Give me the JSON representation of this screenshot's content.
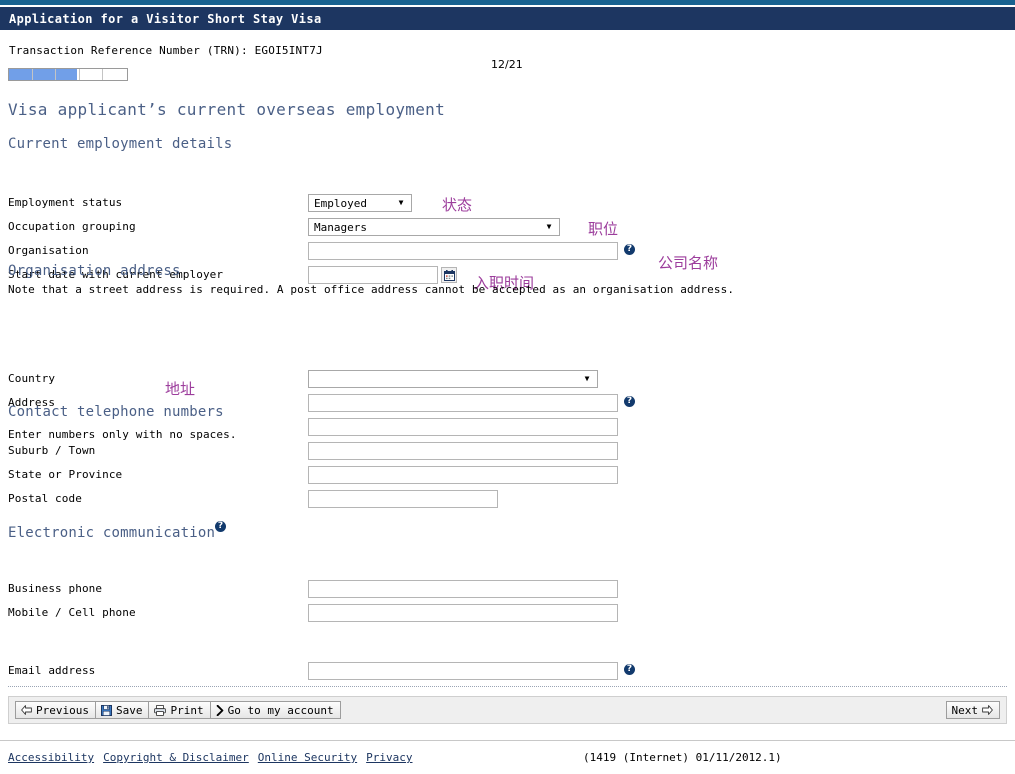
{
  "window": {
    "title": "Application for a Visitor Short Stay Visa"
  },
  "header": {
    "trn_line": "Transaction Reference Number (TRN): EGOI5INT7J",
    "page_counter": "12/21",
    "progress_percent": 58,
    "progress_segments": 5
  },
  "page": {
    "heading": "Visa applicant’s current overseas employment"
  },
  "sections": {
    "current_employment": {
      "heading": "Current employment details",
      "fields": [
        {
          "label": "Employment status",
          "value": "Employed",
          "kind": "select"
        },
        {
          "label": "Occupation grouping",
          "value": "Managers",
          "kind": "select"
        },
        {
          "label": "Organisation",
          "value": "",
          "kind": "text",
          "help": true
        },
        {
          "label": "Start date with current employer",
          "value": "",
          "kind": "date"
        }
      ]
    },
    "organisation_address": {
      "heading": "Organisation address",
      "note": "Note that a street address is required. A post office address cannot be accepted as an organisation address.",
      "fields": [
        {
          "label": "Country",
          "value": "",
          "kind": "select"
        },
        {
          "label": "Address",
          "value": "",
          "kind": "text",
          "help": true
        },
        {
          "label": "",
          "value": "",
          "kind": "text"
        },
        {
          "label": "Suburb / Town",
          "value": "",
          "kind": "text"
        },
        {
          "label": "State or Province",
          "value": "",
          "kind": "text"
        },
        {
          "label": "Postal code",
          "value": "",
          "kind": "text"
        }
      ]
    },
    "contact_telephone": {
      "heading": "Contact telephone numbers",
      "note": "Enter numbers only with no spaces.",
      "fields": [
        {
          "label": "Business phone",
          "value": "",
          "kind": "text"
        },
        {
          "label": "Mobile / Cell phone",
          "value": "",
          "kind": "text"
        }
      ]
    },
    "electronic_communication": {
      "heading": "Electronic communication",
      "fields": [
        {
          "label": "Email address",
          "value": "",
          "kind": "text",
          "help": true
        }
      ]
    }
  },
  "annotations": [
    {
      "text": "状态",
      "refers_to": "Employment status"
    },
    {
      "text": "职位",
      "refers_to": "Occupation grouping"
    },
    {
      "text": "公司名称",
      "refers_to": "Organisation"
    },
    {
      "text": "入职时间",
      "refers_to": "Start date with current employer"
    },
    {
      "text": "地址",
      "refers_to": "Country / Address"
    }
  ],
  "toolbar": {
    "previous_label": "Previous",
    "save_label": "Save",
    "print_label": "Print",
    "account_label": "Go to my account",
    "next_label": "Next"
  },
  "footer": {
    "links": [
      "Accessibility",
      "Copyright & Disclaimer",
      "Online Security",
      "Privacy"
    ],
    "build": "(1419 (Internet) 01/11/2012.1)"
  },
  "colors": {
    "top_strip": "#186290",
    "title_bar": "#1d3661",
    "heading": "#4a5f86",
    "annotation": "#9c3d9c",
    "progress_fill": "#719fe8",
    "help_icon": "#123a6d",
    "link": "#1d3661"
  }
}
